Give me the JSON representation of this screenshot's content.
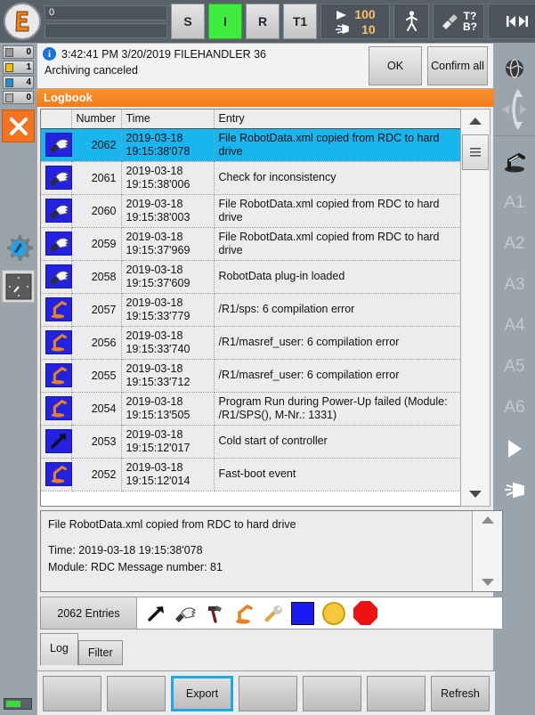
{
  "topbar": {
    "robot_icon": "kuka-robot-logo-icon",
    "field_value": "0",
    "field2_value": "",
    "mode_buttons": [
      {
        "name": "submit-interpreter",
        "label": "S",
        "state": "normal"
      },
      {
        "name": "drives-ready",
        "label": "I",
        "state": "active"
      },
      {
        "name": "robot-interpreter",
        "label": "R",
        "state": "normal"
      },
      {
        "name": "operating-mode",
        "label": "T1",
        "state": "normal"
      }
    ],
    "override": {
      "program_value": "100",
      "jog_value": "10",
      "program_icon": "play-icon",
      "jog_icon": "hand-icon"
    },
    "tool_button": {
      "name": "walk-figure-icon"
    },
    "tcp_button": {
      "name": "tool-icon",
      "top_label": "T?",
      "bottom_label": "B?"
    },
    "increment": {
      "name": "increment-icon",
      "label": "∞"
    }
  },
  "left_rail": {
    "message_counts": [
      {
        "name": "ack-messages",
        "icon": "x-square-icon",
        "count": "0",
        "color": "#9a9a9a"
      },
      {
        "name": "warning-messages",
        "icon": "warning-icon",
        "count": "1",
        "color": "#f2c200"
      },
      {
        "name": "info-messages",
        "icon": "info-icon",
        "count": "4",
        "color": "#1e90d6"
      },
      {
        "name": "wait-messages",
        "icon": "wait-icon",
        "count": "0",
        "color": "#b0b0b0"
      }
    ],
    "stop_button": {
      "name": "stop-close-button",
      "icon": "x-icon",
      "color": "#f47321"
    },
    "settings_icon": "gear-robot-icon",
    "clock_icon": "clock-icon",
    "battery": {
      "name": "battery-indicator",
      "level_percent": "62",
      "color": "#3ddc3d"
    }
  },
  "right_rail": {
    "world_icon": "globe-world-icon",
    "coord_icon": "coordinate-arrows-icon",
    "robot_icon": "robot-axis-icon",
    "axes": [
      "A1",
      "A2",
      "A3",
      "A4",
      "A5",
      "A6"
    ],
    "play_icon": "play-triangle-icon",
    "hand_icon": "hand-jog-icon"
  },
  "message_bar": {
    "icon": "info-circle-icon",
    "timestamp": "3:42:41 PM 3/20/2019",
    "source": "FILEHANDLER 36",
    "header": "3:42:41 PM 3/20/2019 FILEHANDLER 36",
    "text": "Archiving canceled",
    "ok_label": "OK",
    "confirm_all_label": "Confirm all"
  },
  "logbook": {
    "title": "Logbook",
    "columns": [
      "",
      "Number",
      "Time",
      "Entry"
    ],
    "rows": [
      {
        "icon": "hand-pointer-icon",
        "number": "2062",
        "time": "2019-03-18\n19:15:38'078",
        "entry": "File RobotData.xml copied from RDC to hard drive",
        "selected": true
      },
      {
        "icon": "hand-pointer-icon",
        "number": "2061",
        "time": "2019-03-18\n19:15:38'006",
        "entry": "Check for inconsistency",
        "selected": false
      },
      {
        "icon": "hand-pointer-icon",
        "number": "2060",
        "time": "2019-03-18\n19:15:38'003",
        "entry": "File RobotData.xml copied from RDC to hard drive",
        "selected": false
      },
      {
        "icon": "hand-pointer-icon",
        "number": "2059",
        "time": "2019-03-18\n19:15:37'969",
        "entry": "File RobotData.xml copied from RDC to hard drive",
        "selected": false
      },
      {
        "icon": "hand-pointer-icon",
        "number": "2058",
        "time": "2019-03-18\n19:15:37'609",
        "entry": "RobotData plug-in loaded",
        "selected": false
      },
      {
        "icon": "robot-icon",
        "number": "2057",
        "time": "2019-03-18\n19:15:33'779",
        "entry": "/R1/sps: 6 compilation error",
        "selected": false
      },
      {
        "icon": "robot-icon",
        "number": "2056",
        "time": "2019-03-18\n19:15:33'740",
        "entry": "/R1/masref_user: 6 compilation error",
        "selected": false
      },
      {
        "icon": "robot-icon",
        "number": "2055",
        "time": "2019-03-18\n19:15:33'712",
        "entry": "/R1/masref_user: 6 compilation error",
        "selected": false
      },
      {
        "icon": "robot-icon",
        "number": "2054",
        "time": "2019-03-18\n19:15:13'505",
        "entry": "Program Run during Power-Up failed (Module: /R1/SPS(), M-Nr.: 1331)",
        "selected": false
      },
      {
        "icon": "arrow-icon",
        "number": "2053",
        "time": "2019-03-18\n19:15:12'017",
        "entry": "Cold start of controller",
        "selected": false
      },
      {
        "icon": "robot-icon",
        "number": "2052",
        "time": "2019-03-18\n19:15:12'014",
        "entry": "Fast-boot event",
        "selected": false
      }
    ],
    "scrollbar": {
      "up_icon": "chevron-up-icon",
      "thumb_icon": "grip-lines-icon",
      "down_icon": "chevron-down-icon"
    }
  },
  "detail": {
    "line1": "File RobotData.xml copied from RDC to hard drive",
    "line2": "Time: 2019-03-18 19:15:38'078",
    "line3": "Module: RDC  Message number: 81",
    "scrollbar": {
      "up_icon": "chevron-up-icon",
      "down_icon": "chevron-down-icon"
    }
  },
  "filter_row": {
    "entries_label": "2062 Entries",
    "filter_icons": [
      {
        "name": "filter-arrow-icon"
      },
      {
        "name": "filter-hand-pointer-icon"
      },
      {
        "name": "filter-hammer-icon"
      },
      {
        "name": "filter-robot-icon"
      },
      {
        "name": "filter-wrench-icon"
      },
      {
        "name": "filter-blue-square-icon",
        "color": "#1a1af0"
      },
      {
        "name": "filter-yellow-circle-icon",
        "color": "#f5c842"
      },
      {
        "name": "filter-red-octagon-icon",
        "color": "#ee1111"
      }
    ]
  },
  "tabs": [
    {
      "name": "tab-log",
      "label": "Log",
      "active": true
    },
    {
      "name": "tab-filter",
      "label": "Filter",
      "active": false
    }
  ],
  "footer_buttons": [
    {
      "name": "softkey-1",
      "label": "",
      "focus": false
    },
    {
      "name": "softkey-2",
      "label": "",
      "focus": false
    },
    {
      "name": "softkey-export",
      "label": "Export",
      "focus": true
    },
    {
      "name": "softkey-4",
      "label": "",
      "focus": false
    },
    {
      "name": "softkey-5",
      "label": "",
      "focus": false
    },
    {
      "name": "softkey-6",
      "label": "",
      "focus": false
    },
    {
      "name": "softkey-refresh",
      "label": "Refresh",
      "focus": false
    }
  ],
  "colors": {
    "accent_orange": "#f47321",
    "selection_blue": "#19b5ee",
    "panel_grey": "#ececec",
    "rail_grey": "#9aa4ac",
    "toolbar_dark": "#5a6169",
    "active_green": "#3dec3d"
  }
}
